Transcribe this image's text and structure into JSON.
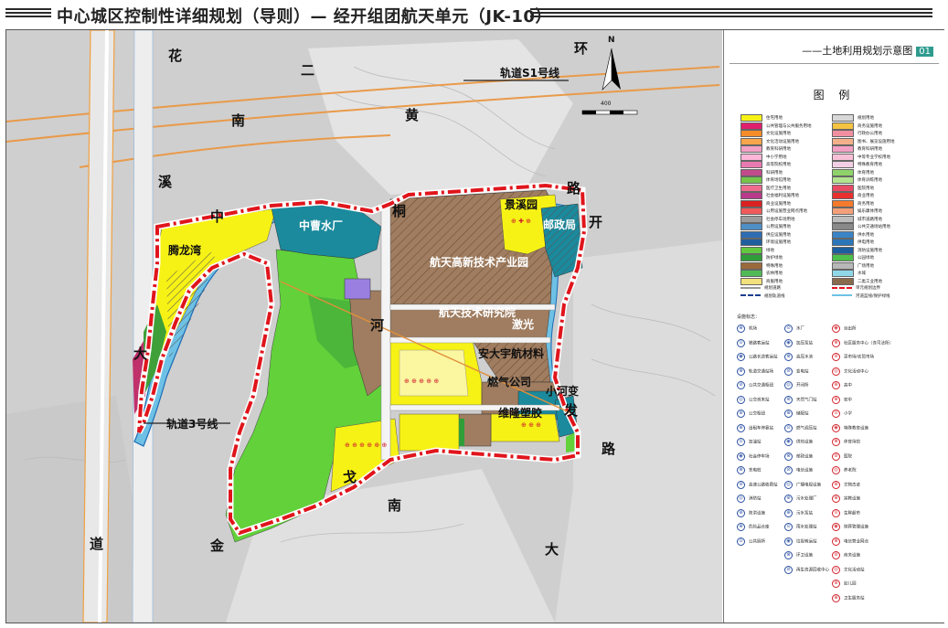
{
  "header": {
    "title": "中心城区控制性详细规划（导则）— 经开组团航天单元（JK-10）"
  },
  "legend": {
    "title": "——土地利用规划示意图",
    "badge": "01",
    "heading": "图 例",
    "facilities_heading": "设施标志："
  },
  "land_use": [
    {
      "name": "住宅用地",
      "color": "#f7f215"
    },
    {
      "name": "公共管理与公共服务用地",
      "color": "#e0206e"
    },
    {
      "name": "文化设施用地",
      "color": "#f58c2a"
    },
    {
      "name": "文化活动设施用地",
      "color": "#f7a64c"
    },
    {
      "name": "教育科研用地",
      "color": "#f3a0c4"
    },
    {
      "name": "中小学用地",
      "color": "#ffb6d9"
    },
    {
      "name": "高等院校用地",
      "color": "#e87ab2"
    },
    {
      "name": "科研用地",
      "color": "#c24b8b"
    },
    {
      "name": "体育场馆用地",
      "color": "#76c44c"
    },
    {
      "name": "医疗卫生用地",
      "color": "#ef6c8f"
    },
    {
      "name": "社会福利设施用地",
      "color": "#b93b8a"
    },
    {
      "name": "商业设施用地",
      "color": "#d92121"
    },
    {
      "name": "公用设施营业网点用地",
      "color": "#f05a5a"
    },
    {
      "name": "社会停车场用地",
      "color": "#9c9c9c"
    },
    {
      "name": "公用设施用地",
      "color": "#4f8fc5"
    },
    {
      "name": "供应设施用地",
      "color": "#2f6db3"
    },
    {
      "name": "环境设施用地",
      "color": "#1f5f9e"
    },
    {
      "name": "绿地",
      "color": "#62c83f"
    },
    {
      "name": "防护绿地",
      "color": "#2f9e3a"
    },
    {
      "name": "特殊用地",
      "color": "#9a6a3c"
    },
    {
      "name": "农林用地",
      "color": "#4fba56"
    },
    {
      "name": "商服用地",
      "color": "#f2e07c"
    },
    {
      "name": "规划用地",
      "color": "#d8d8d8"
    },
    {
      "name": "商务设施用地",
      "color": "#f5c342"
    },
    {
      "name": "行政办公用地",
      "color": "#f08fa0"
    },
    {
      "name": "图书、展览设施用地",
      "color": "#f4b08a"
    },
    {
      "name": "教育科研用地",
      "color": "#f3a0c4"
    },
    {
      "name": "中等专业学校用地",
      "color": "#f8c0d6"
    },
    {
      "name": "特殊教育用地",
      "color": "#f2cfe4"
    },
    {
      "name": "体育用地",
      "color": "#8fd36a"
    },
    {
      "name": "体育训练用地",
      "color": "#b2e38e"
    },
    {
      "name": "医院用地",
      "color": "#e84a64"
    },
    {
      "name": "商业用地",
      "color": "#e8312f"
    },
    {
      "name": "商务用地",
      "color": "#f57a2c"
    },
    {
      "name": "娱乐康体用地",
      "color": "#f3a07a"
    },
    {
      "name": "城市道路用地",
      "color": "#bdbdbd"
    },
    {
      "name": "公共交通场站用地",
      "color": "#8a8a8a"
    },
    {
      "name": "供水用地",
      "color": "#3a84c6"
    },
    {
      "name": "供电用地",
      "color": "#2b75b9"
    },
    {
      "name": "消防设施用地",
      "color": "#1d5e9f"
    },
    {
      "name": "公园绿地",
      "color": "#4cc04a"
    },
    {
      "name": "广场用地",
      "color": "#b8b8b8"
    },
    {
      "name": "水域",
      "color": "#8fd8e9"
    },
    {
      "name": "二类工业用地",
      "color": "#8a6a4c"
    }
  ],
  "line_items": [
    {
      "name": "单元规划边界",
      "style": "boundary"
    },
    {
      "name": "河道蓝线/保护绿线",
      "style": "river"
    },
    {
      "name": "规划道路",
      "style": "road"
    },
    {
      "name": "规划轨道线",
      "style": "rail"
    }
  ],
  "facilities": [
    [
      "机场",
      "水厂",
      "派出所"
    ],
    [
      "铁路客运站",
      "加压泵站",
      "社区服务中心（含司法所）"
    ],
    [
      "公路长途客运站",
      "高压水池",
      "菜市场/农贸市场"
    ],
    [
      "轨道交通站场",
      "变电站",
      "文化活动中心"
    ],
    [
      "公共交通枢纽",
      "开闭所",
      "高中"
    ],
    [
      "公交首末站",
      "天然气门站",
      "初中"
    ],
    [
      "公交枢纽",
      "储配站",
      "小学"
    ],
    [
      "出租车停靠站",
      "燃气调压站",
      "特殊教育设施"
    ],
    [
      "加油站",
      "供热设施",
      "体育场馆"
    ],
    [
      "社会停车场",
      "邮政设施",
      "医院"
    ],
    [
      "充电桩",
      "电信设施",
      "养老院"
    ],
    [
      "高速公路收费站",
      "广播电视设施",
      "文物古迹"
    ],
    [
      "消防站",
      "污水处理厂",
      "宗教设施"
    ],
    [
      "防洪设施",
      "污水泵站",
      "生鲜超市"
    ],
    [
      "危险品仓库",
      "雨水处理站",
      "殡葬管理设施"
    ],
    [
      "公共厕所",
      "垃圾转运站",
      "电信营业网点"
    ],
    [
      "",
      "环卫设施",
      "商务设施"
    ],
    [
      "",
      "再生资源回收中心",
      "文化活动站"
    ],
    [
      "",
      "",
      "幼儿园"
    ],
    [
      "",
      "",
      "卫生服务站"
    ]
  ],
  "map": {
    "roads": [
      {
        "name": "花溪大道",
        "chars": [
          "花",
          "南",
          "溪",
          "大",
          "道"
        ]
      },
      {
        "name": "二环路",
        "chars": [
          "二",
          "环",
          "路"
        ]
      },
      {
        "name": "黄河路",
        "chars": [
          "黄",
          "河"
        ]
      },
      {
        "name": "开发大道",
        "chars": [
          "开",
          "发",
          "大"
        ]
      },
      {
        "name": "中曹路",
        "chars": [
          "中",
          "桐"
        ]
      },
      {
        "name": "金戈南路",
        "chars": [
          "金",
          "戈",
          "南",
          "路"
        ]
      }
    ],
    "rail_labels": [
      "轨道S1号线",
      "轨道3号线"
    ],
    "place_labels": [
      "腾龙湾",
      "中曹水厂",
      "景溪园",
      "邮政局",
      "航天高新技术产业园",
      "航天技术研究院",
      "激光",
      "安大宇航材料",
      "燃气公司",
      "小河变",
      "维隆塑胶"
    ],
    "scale_label": "400",
    "north_label": "N"
  }
}
